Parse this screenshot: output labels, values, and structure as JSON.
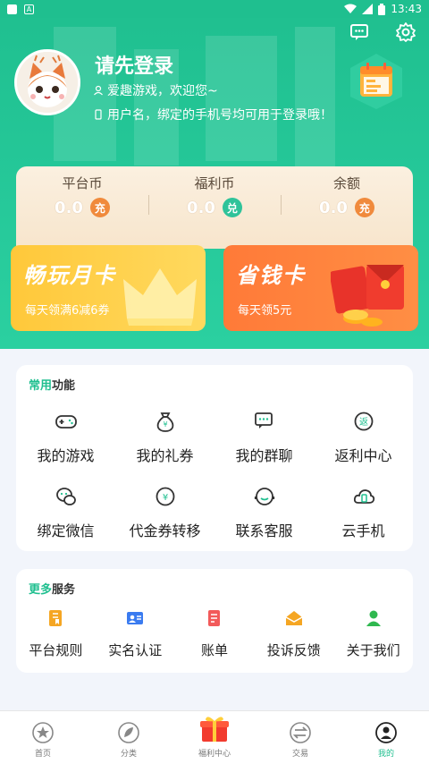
{
  "status_bar": {
    "time": "13:43"
  },
  "profile": {
    "login_prompt": "请先登录",
    "greeting": "爱趣游戏，欢迎您~",
    "tip": "用户名，绑定的手机号均可用于登录哦！"
  },
  "wallet": [
    {
      "label": "平台币",
      "value": "0.0",
      "badge": "充",
      "badge_color": "#f08a3c"
    },
    {
      "label": "福利币",
      "value": "0.0",
      "badge": "兑",
      "badge_color": "#2fc39a"
    },
    {
      "label": "余额",
      "value": "0.0",
      "badge": "充",
      "badge_color": "#f08a3c"
    }
  ],
  "promos": {
    "monthly": {
      "title": "畅玩月卡",
      "subtitle": "每天领满6减6券"
    },
    "saver": {
      "title": "省钱卡",
      "subtitle": "每天领5元"
    }
  },
  "common": {
    "title_accent": "常用",
    "title_rest": "功能",
    "items": [
      {
        "label": "我的游戏",
        "icon": "gamepad-icon"
      },
      {
        "label": "我的礼券",
        "icon": "money-bag-icon"
      },
      {
        "label": "我的群聊",
        "icon": "group-chat-icon"
      },
      {
        "label": "返利中心",
        "icon": "rebate-icon"
      },
      {
        "label": "绑定微信",
        "icon": "wechat-icon"
      },
      {
        "label": "代金券转移",
        "icon": "voucher-transfer-icon"
      },
      {
        "label": "联系客服",
        "icon": "customer-service-icon"
      },
      {
        "label": "云手机",
        "icon": "cloud-phone-icon"
      }
    ]
  },
  "more": {
    "title_accent": "更多",
    "title_rest": "服务",
    "items": [
      {
        "label": "平台规则",
        "icon": "rules-icon",
        "color": "#f5a623"
      },
      {
        "label": "实名认证",
        "icon": "id-card-icon",
        "color": "#3a7bf0"
      },
      {
        "label": "账单",
        "icon": "bill-icon",
        "color": "#f25a5a"
      },
      {
        "label": "投诉反馈",
        "icon": "feedback-icon",
        "color": "#f5a623"
      },
      {
        "label": "关于我们",
        "icon": "about-icon",
        "color": "#2fb84f"
      }
    ]
  },
  "bottom_nav": [
    {
      "label": "首页",
      "icon": "home-star-icon"
    },
    {
      "label": "分类",
      "icon": "category-icon"
    },
    {
      "label": "福利中心",
      "icon": "gift-icon"
    },
    {
      "label": "交易",
      "icon": "trade-icon"
    },
    {
      "label": "我的",
      "icon": "profile-icon",
      "active": true
    }
  ],
  "colors": {
    "brand": "#1fbf8f",
    "promo_yellow": "#ffc83a",
    "promo_orange": "#ff7a38"
  }
}
